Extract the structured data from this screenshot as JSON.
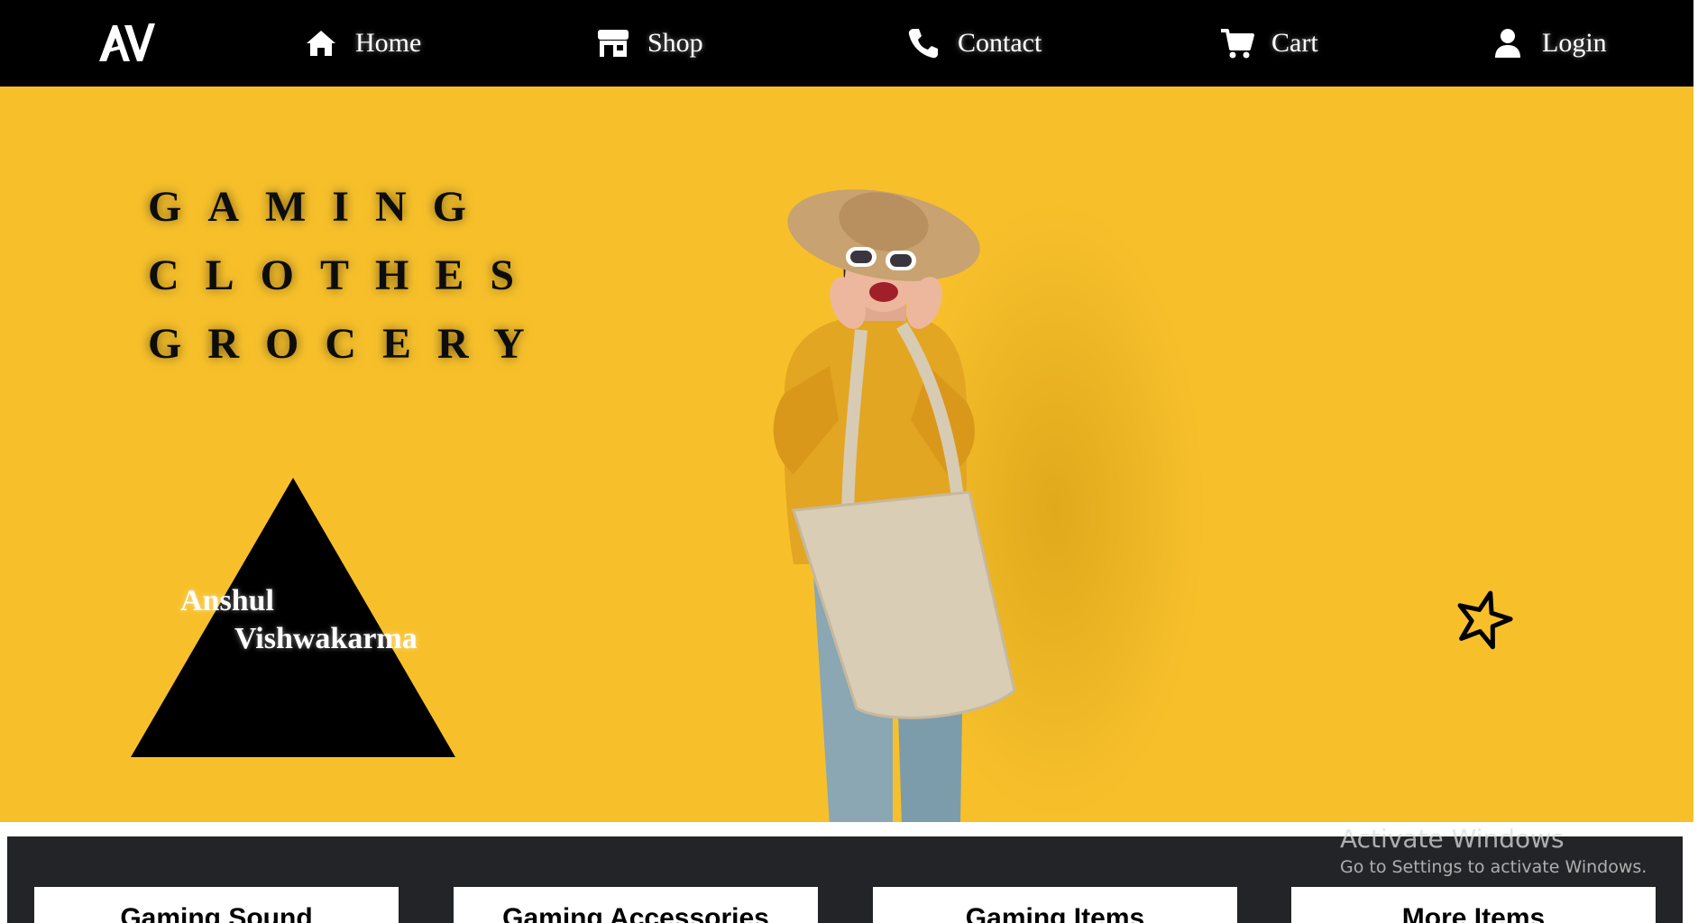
{
  "brand": {
    "logo_text": "AV"
  },
  "nav": {
    "items": [
      {
        "label": "Home",
        "icon": "home-icon"
      },
      {
        "label": "Shop",
        "icon": "store-icon"
      },
      {
        "label": "Contact",
        "icon": "phone-icon"
      },
      {
        "label": "Cart",
        "icon": "cart-icon"
      },
      {
        "label": "Login",
        "icon": "user-icon"
      }
    ]
  },
  "hero": {
    "words": [
      "GAMING",
      "CLOTHES",
      "GROCERY"
    ],
    "author_first": "Anshul",
    "author_last": "Vishwakarma"
  },
  "categories": [
    {
      "label": "Gaming Sound"
    },
    {
      "label": "Gaming Accessories"
    },
    {
      "label": "Gaming Items"
    },
    {
      "label": "More Items"
    }
  ],
  "watermark": {
    "title": "Activate Windows",
    "subtitle": "Go to Settings to activate Windows."
  },
  "colors": {
    "nav_bg": "#000000",
    "hero_bg": "#f7c02b",
    "strip_bg": "#222427",
    "card_bg": "#ffffff"
  }
}
